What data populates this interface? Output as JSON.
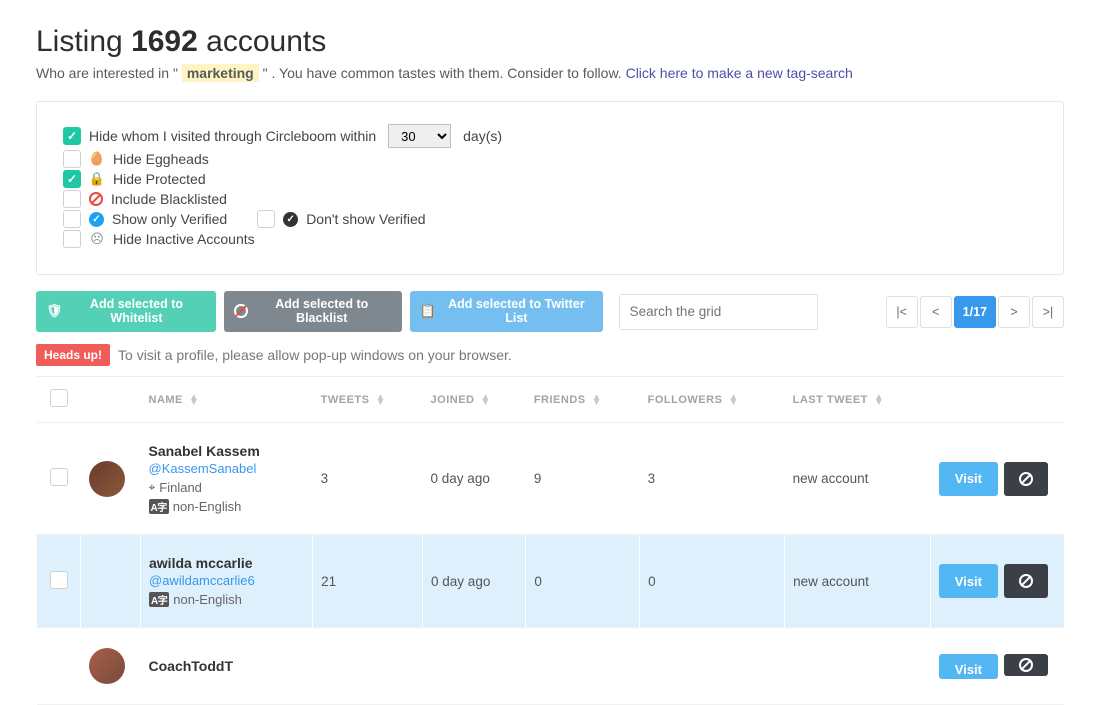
{
  "header": {
    "listing_prefix": "Listing ",
    "count": "1692",
    "accounts_suffix": " accounts",
    "sub_prefix": "Who are interested in \" ",
    "tag": "marketing",
    "sub_mid": " \" . You have common tastes with them. Consider to follow. ",
    "search_link": "Click here to make a new tag-search"
  },
  "filters": {
    "hide_visited": {
      "checked": true,
      "label_pre": "Hide whom I visited through Circleboom within",
      "label_post": " day(s)",
      "days": "30"
    },
    "hide_eggheads": {
      "checked": false,
      "label": "Hide Eggheads"
    },
    "hide_protected": {
      "checked": true,
      "label": "Hide Protected"
    },
    "include_blacklist": {
      "checked": false,
      "label": "Include Blacklisted"
    },
    "show_verified": {
      "checked": false,
      "label": "Show only Verified"
    },
    "dont_show_verified": {
      "checked": false,
      "label": "Don't show Verified"
    },
    "hide_inactive": {
      "checked": false,
      "label": "Hide Inactive Accounts"
    }
  },
  "actions": {
    "whitelist": "Add selected to Whitelist",
    "blacklist": "Add selected to Blacklist",
    "twitterlist": "Add selected to Twitter List",
    "search_placeholder": "Search the grid"
  },
  "pager": {
    "first": "|<",
    "prev": "<",
    "state": "1/17",
    "next": ">",
    "last": ">|"
  },
  "heads": {
    "badge": "Heads up!",
    "text": "To visit a profile, please allow pop-up windows on your browser."
  },
  "columns": {
    "name": "NAME",
    "tweets": "TWEETS",
    "joined": "JOINED",
    "friends": "FRIENDS",
    "followers": "FOLLOWERS",
    "last": "LAST TWEET"
  },
  "buttons": {
    "visit": "Visit"
  },
  "rows": [
    {
      "name": "Sanabel Kassem",
      "handle": "@KassemSanabel",
      "location": "Finland",
      "lang": "non-English",
      "tweets": "3",
      "joined": "0 day ago",
      "friends": "9",
      "followers": "3",
      "last": "new account",
      "show_location": true,
      "avatar_class": "a1"
    },
    {
      "name": "awilda mccarlie",
      "handle": "@awildamccarlie6",
      "location": "",
      "lang": "non-English",
      "tweets": "21",
      "joined": "0 day ago",
      "friends": "0",
      "followers": "0",
      "last": "new account",
      "show_location": false,
      "avatar_class": "a2"
    },
    {
      "name": "CoachToddT",
      "handle": "",
      "location": "",
      "lang": "",
      "tweets": "",
      "joined": "",
      "friends": "",
      "followers": "",
      "last": "",
      "avatar_class": "a3"
    }
  ]
}
